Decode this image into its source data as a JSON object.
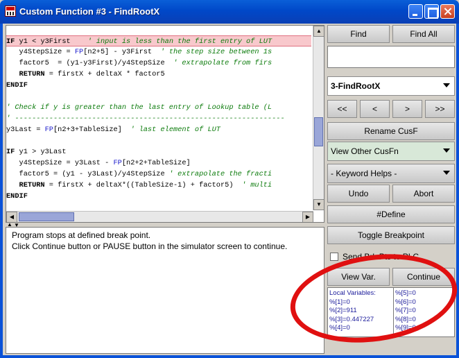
{
  "window": {
    "title": "Custom Function #3 - FindRootX"
  },
  "code_lines": [
    {
      "parts": [
        [
          "kw",
          "IF "
        ],
        [
          "",
          "y1 < y3First    "
        ],
        [
          "cm",
          "' input is less than the first entry of LUT"
        ]
      ],
      "highlight": true
    },
    {
      "parts": [
        [
          "",
          "   y4StepSize = "
        ],
        [
          "fp",
          "FP"
        ],
        [
          "",
          "[n2+5] - y3First  "
        ],
        [
          "cm",
          "' the step size between 1s"
        ]
      ]
    },
    {
      "parts": [
        [
          "",
          "   factor5  = (y1-y3First)/y4StepSize  "
        ],
        [
          "cm",
          "' extrapolate from firs"
        ]
      ]
    },
    {
      "parts": [
        [
          "kw",
          "   RETURN "
        ],
        [
          "",
          "= firstX + deltaX * factor5"
        ]
      ]
    },
    {
      "parts": [
        [
          "kw",
          "ENDIF"
        ]
      ]
    },
    {
      "parts": [
        [
          "",
          ""
        ]
      ]
    },
    {
      "parts": [
        [
          "cm",
          "' Check if y is greater than the last entry of Lookup table (L"
        ]
      ]
    },
    {
      "parts": [
        [
          "cm",
          "' ---------------------------------------------------------------"
        ]
      ]
    },
    {
      "parts": [
        [
          "",
          "y3Last = "
        ],
        [
          "fp",
          "FP"
        ],
        [
          "",
          "[n2+3+TableSize]  "
        ],
        [
          "cm",
          "' last element of LUT"
        ]
      ]
    },
    {
      "parts": [
        [
          "",
          ""
        ]
      ]
    },
    {
      "parts": [
        [
          "kw",
          "IF "
        ],
        [
          "",
          "y1 > y3Last"
        ]
      ]
    },
    {
      "parts": [
        [
          "",
          "   y4StepSize = y3Last - "
        ],
        [
          "fp",
          "FP"
        ],
        [
          "",
          "[n2+2+TableSize]"
        ]
      ]
    },
    {
      "parts": [
        [
          "",
          "   factor5 = (y1 - y3Last)/y4StepSize "
        ],
        [
          "cm",
          "' extrapolate the fracti"
        ]
      ]
    },
    {
      "parts": [
        [
          "kw",
          "   RETURN "
        ],
        [
          "",
          "= firstX + deltaX*((TableSize-1) + factor5)  "
        ],
        [
          "cm",
          "' multi"
        ]
      ]
    },
    {
      "parts": [
        [
          "kw",
          "ENDIF"
        ]
      ]
    }
  ],
  "output": {
    "line1": "Program stops at defined break point.",
    "line2": "Click Continue button or PAUSE button in the simulator screen to continue."
  },
  "panel": {
    "find": "Find",
    "find_all": "Find All",
    "search_value": "",
    "function_select": "3-FindRootX",
    "nav_first": "<<",
    "nav_prev": "<",
    "nav_next": ">",
    "nav_last": ">>",
    "rename": "Rename CusF",
    "view_other": "View Other CusFn",
    "keyword_helps": "- Keyword Helps -",
    "undo": "Undo",
    "abort": "Abort",
    "define": "#Define",
    "toggle_breakpoint": "Toggle Breakpoint",
    "send_brk": "Send Brk.Pts to PLC",
    "view_var": "View Var.",
    "continue": "Continue"
  },
  "variables": {
    "heading": "Local Variables:",
    "left": [
      "%[1]=0",
      "%[2]=911",
      "%[3]=0.447227",
      "%[4]=0"
    ],
    "right": [
      "%[5]=0",
      "%[6]=0",
      "%[7]=0",
      "%[8]=0",
      "%[9]=0"
    ]
  },
  "colors": {
    "highlight": "#f8c8cc",
    "comment": "#0a7a0a",
    "keyword_fp": "#1a1acc",
    "annotation": "#e01010"
  }
}
